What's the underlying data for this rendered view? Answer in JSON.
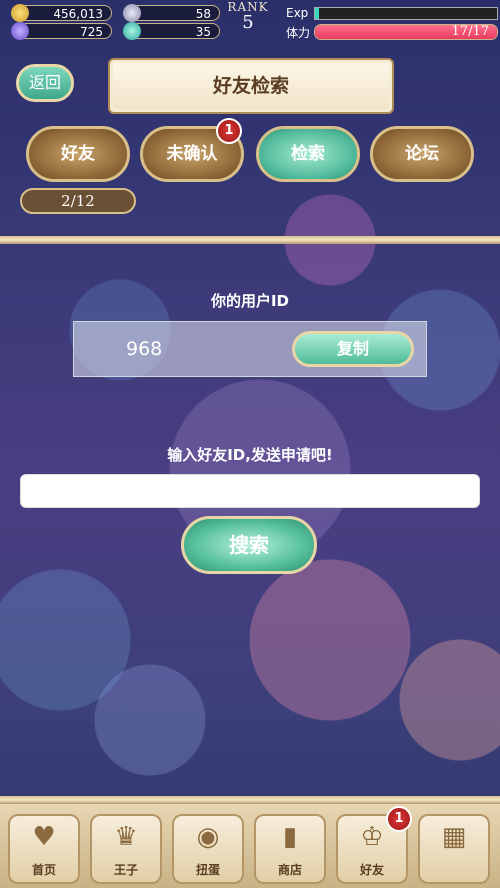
{
  "status": {
    "gold": "456,013",
    "item2": "58",
    "gems": "725",
    "item4": "35",
    "rank_label": "RANK",
    "rank_value": "5",
    "exp_label": "Exp",
    "stamina_label": "体力",
    "stamina_text": "17/17",
    "stamina_fraction": 1.0,
    "exp_fraction": 0.02
  },
  "header": {
    "title": "好友检索",
    "back_label": "返回"
  },
  "tabs": [
    {
      "label": "好友"
    },
    {
      "label": "未确认",
      "badge": "1"
    },
    {
      "label": "检索"
    },
    {
      "label": "论坛"
    }
  ],
  "friend_count": "2/12",
  "user_id": {
    "label": "你的用户ID",
    "value": "968",
    "copy_label": "复制"
  },
  "search": {
    "prompt": "输入好友ID,发送申请吧!",
    "input_value": "",
    "button_label": "搜索"
  },
  "bottom_nav": [
    {
      "label": "首页"
    },
    {
      "label": "王子"
    },
    {
      "label": "扭蛋"
    },
    {
      "label": "商店"
    },
    {
      "label": "好友",
      "badge": "1"
    },
    {
      "label": ""
    }
  ],
  "colors": {
    "teal_button": "#4fbb98",
    "brown_button": "#8a6434",
    "stamina_bar": "#e83c5e",
    "badge_red": "#c02020"
  }
}
